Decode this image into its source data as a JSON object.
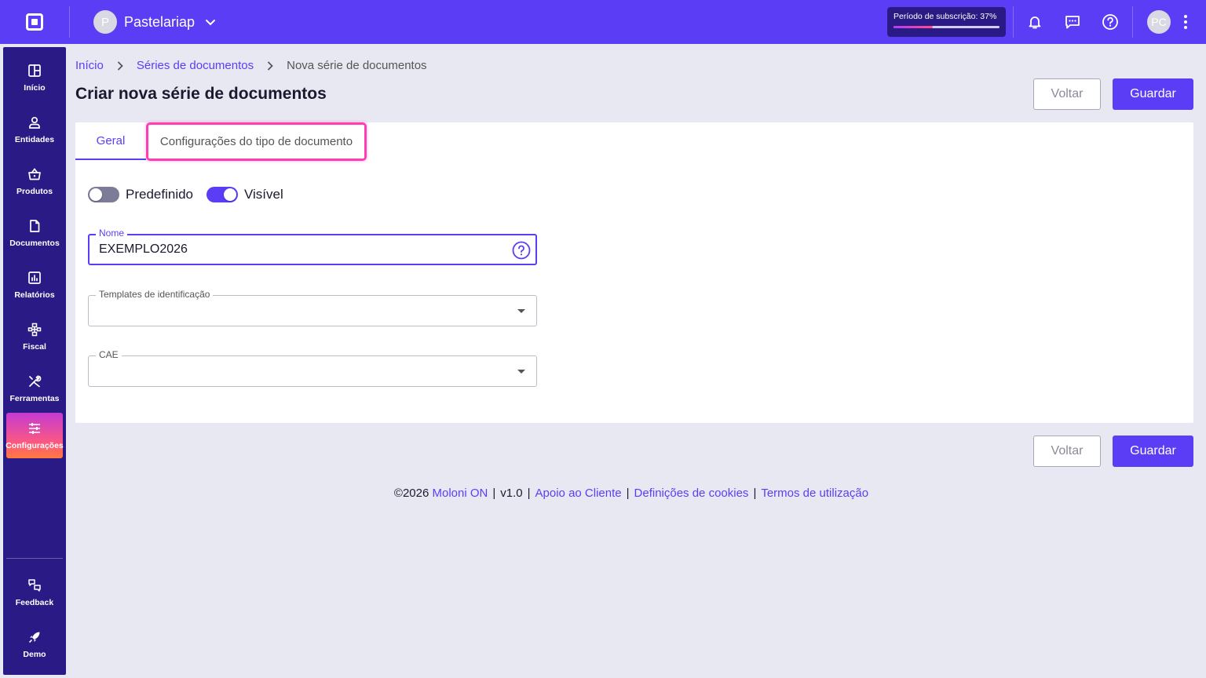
{
  "header": {
    "company_initial": "P",
    "company_name": "Pastelariap",
    "subscription_label": "Período de subscrição: 37%",
    "subscription_progress": 0.37,
    "user_initials": "PC"
  },
  "sidebar": {
    "items": [
      {
        "label": "Início",
        "icon": "grid-icon"
      },
      {
        "label": "Entidades",
        "icon": "user-icon"
      },
      {
        "label": "Produtos",
        "icon": "basket-icon"
      },
      {
        "label": "Documentos",
        "icon": "file-icon"
      },
      {
        "label": "Relatórios",
        "icon": "chart-icon"
      },
      {
        "label": "Fiscal",
        "icon": "hierarchy-icon"
      },
      {
        "label": "Ferramentas",
        "icon": "tools-icon"
      },
      {
        "label": "Configurações",
        "icon": "sliders-icon",
        "active": true
      }
    ],
    "bottom": [
      {
        "label": "Feedback",
        "icon": "feedback-icon"
      },
      {
        "label": "Demo",
        "icon": "rocket-icon"
      }
    ]
  },
  "breadcrumb": {
    "home": "Início",
    "series": "Séries de documentos",
    "current": "Nova série de documentos"
  },
  "page": {
    "title": "Criar nova série de documentos",
    "back_label": "Voltar",
    "save_label": "Guardar"
  },
  "tabs": {
    "general": "Geral",
    "doc_type_settings": "Configurações do tipo de documento"
  },
  "form": {
    "default_label": "Predefinido",
    "default_on": false,
    "visible_label": "Visível",
    "visible_on": true,
    "name_label": "Nome",
    "name_value": "EXEMPLO2026",
    "templates_label": "Templates de identificação",
    "templates_value": "",
    "cae_label": "CAE",
    "cae_value": ""
  },
  "footer": {
    "copyright": "©2026",
    "brand": "Moloni ON",
    "version": "v1.0",
    "support": "Apoio ao Cliente",
    "cookies": "Definições de cookies",
    "terms": "Termos de utilização"
  },
  "colors": {
    "primary": "#5b3df5",
    "sidebar": "#2a1a85",
    "highlight": "#ff3db5"
  }
}
